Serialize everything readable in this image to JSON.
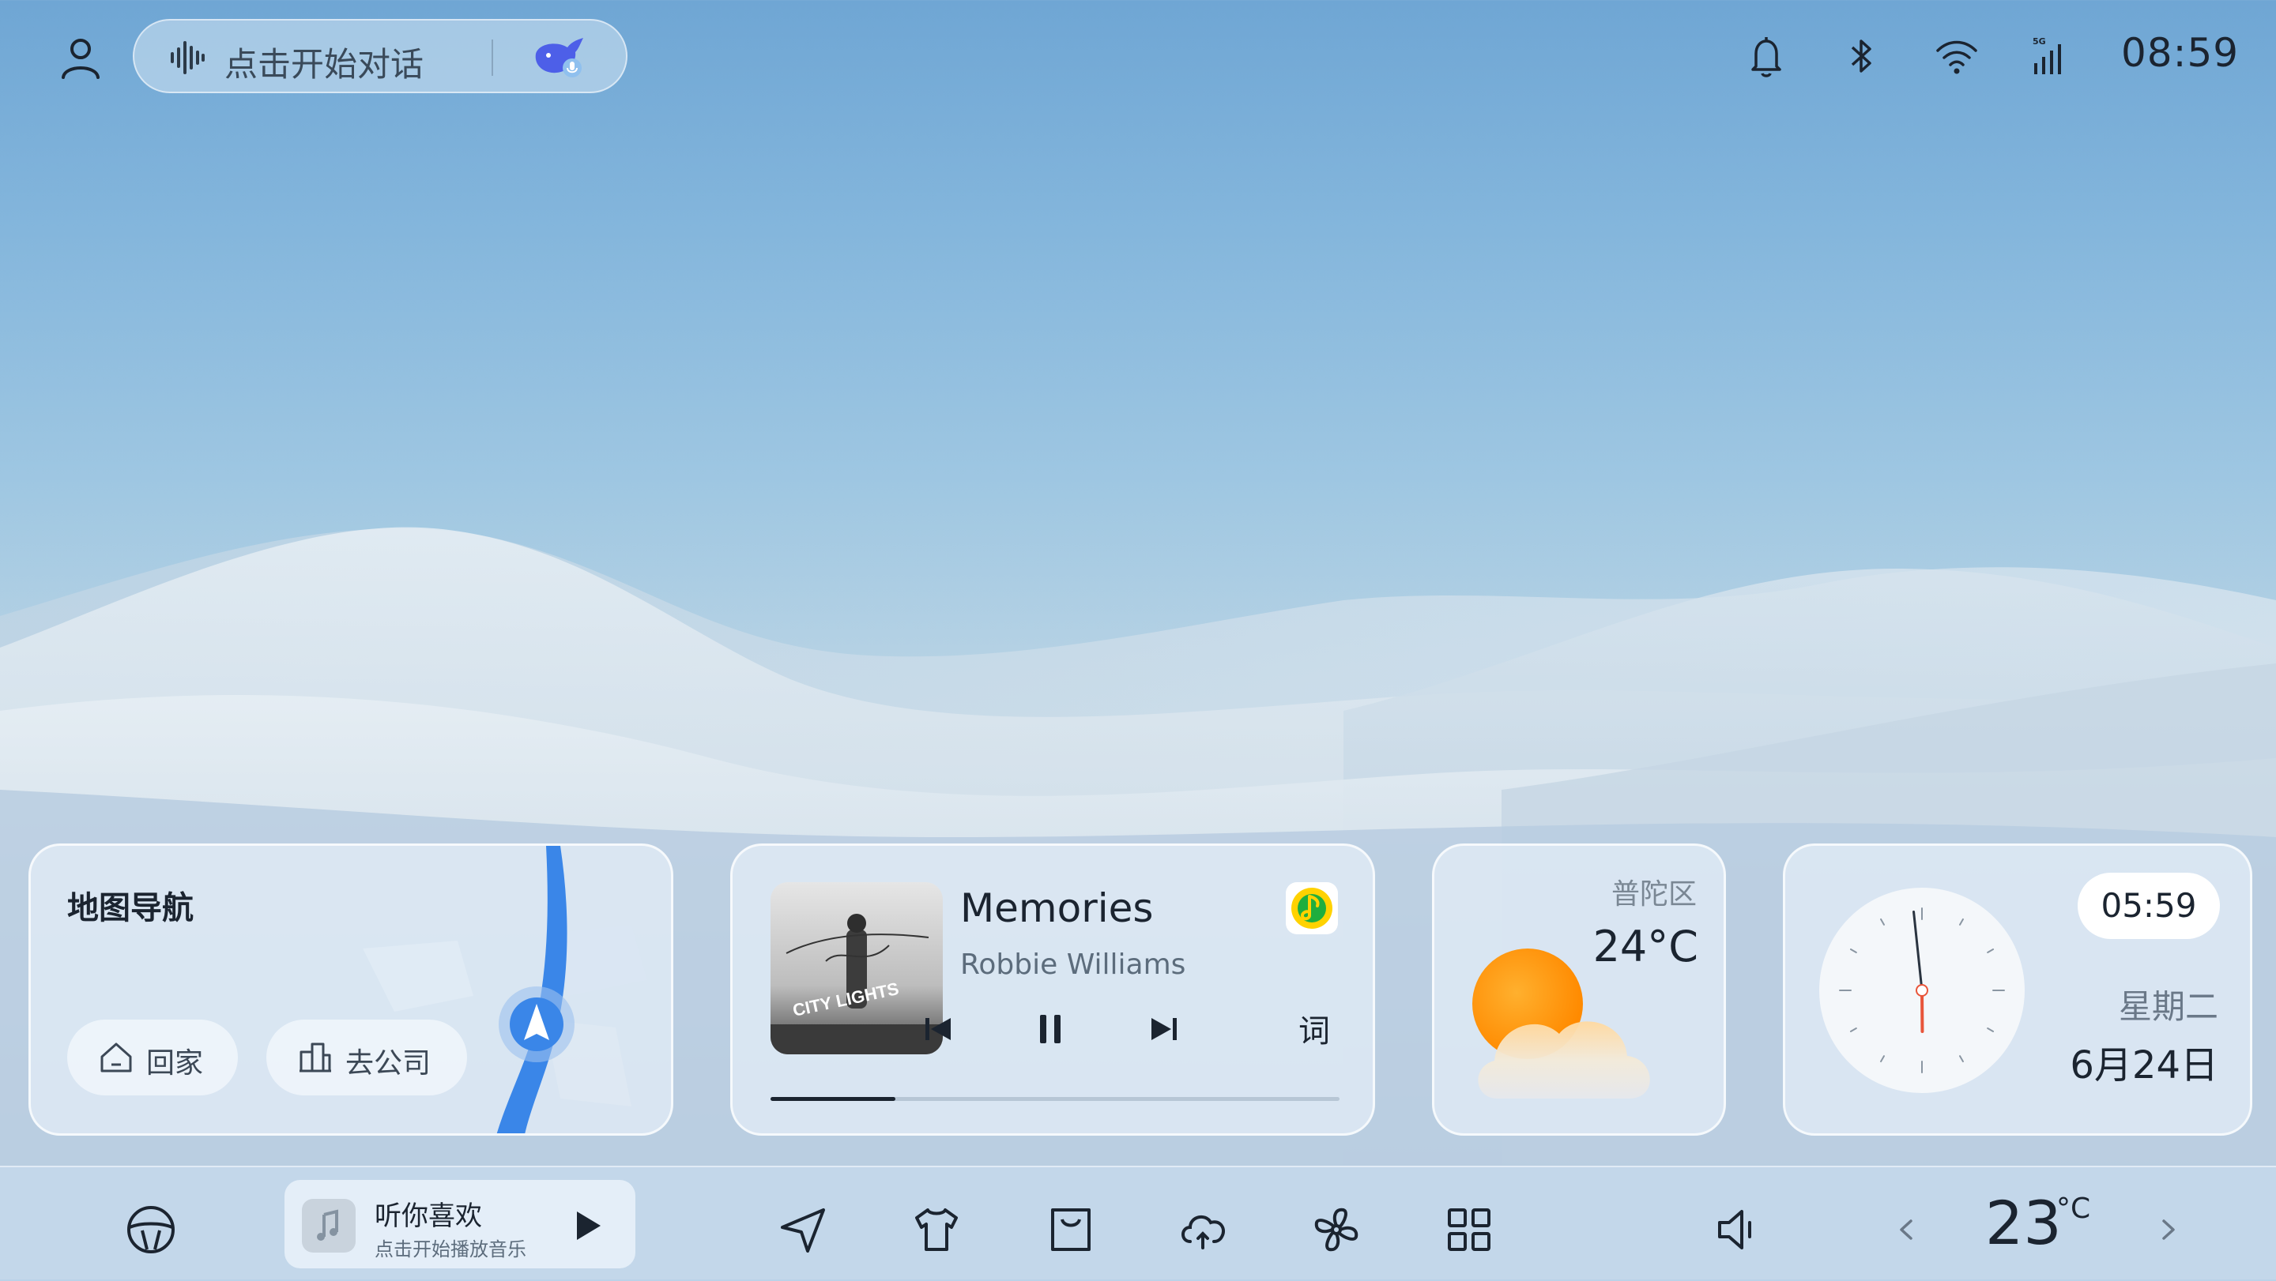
{
  "top_bar": {
    "voice_assistant_placeholder": "点击开始对话",
    "time": "08:59",
    "status_icons": [
      "bell-icon",
      "bluetooth-icon",
      "wifi-icon",
      "5g-signal-icon"
    ],
    "signal_label": "5G"
  },
  "nav_card": {
    "title": "地图导航",
    "home_label": "回家",
    "work_label": "去公司"
  },
  "music_card": {
    "song_title": "Memories",
    "artist": "Robbie Williams",
    "lyrics_label": "词",
    "progress": 0.22,
    "album_art_text": "CITY LIGHTS",
    "app_icon": "qq-music-icon"
  },
  "weather_card": {
    "district": "普陀区",
    "temperature": "24°C",
    "condition_icon": "partly-cloudy-icon"
  },
  "clock_card": {
    "digital_time": "05:59",
    "weekday": "星期二",
    "date": "6月24日",
    "analog_hour": 5,
    "analog_minute": 59
  },
  "dock": {
    "mini_player_title": "听你喜欢",
    "mini_player_subtitle": "点击开始播放音乐",
    "temperature_value": "23",
    "temperature_unit": "°C",
    "icons": [
      "steering-wheel-icon",
      "navigation-icon",
      "shirt-icon",
      "bag-icon",
      "cloud-icon",
      "fan-icon",
      "apps-grid-icon",
      "volume-icon"
    ]
  },
  "colors": {
    "accent_blue": "#3a86e8",
    "sun_orange": "#ff9a12",
    "clock_hand_red": "#e8553a",
    "qq_yellow": "#ffd200",
    "qq_green": "#1fae3e"
  }
}
